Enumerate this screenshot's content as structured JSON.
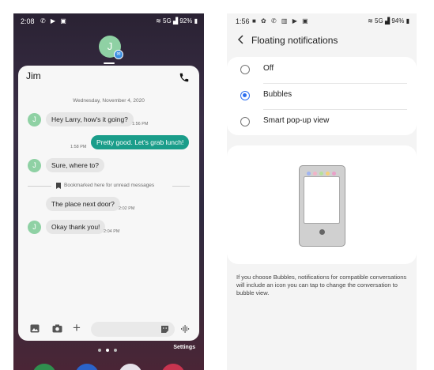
{
  "left_phone": {
    "status": {
      "time": "2:08",
      "battery": "92%",
      "network": "5G"
    },
    "bubble_initial": "J",
    "chat": {
      "contact_name": "Jim",
      "date_separator": "Wednesday, November 4, 2020",
      "messages": [
        {
          "direction": "in",
          "text": "Hey Larry, how's it going?",
          "time": "1:56 PM",
          "avatar": "J"
        },
        {
          "direction": "out",
          "text": "Pretty good. Let's grab lunch!",
          "time": "1:58 PM"
        },
        {
          "direction": "in",
          "text": "Sure, where to?",
          "time": "",
          "avatar": "J"
        },
        {
          "direction": "in",
          "text": "The place next door?",
          "time": "2:02 PM",
          "avatar": ""
        },
        {
          "direction": "in",
          "text": "Okay thank you!",
          "time": "2:04 PM",
          "avatar": "J"
        }
      ],
      "bookmark_text": "Bookmarked here for unread messages"
    },
    "settings_label": "Settings",
    "colors": {
      "bubble": "#1a9d8a",
      "avatar": "#8fd1a4"
    }
  },
  "right_phone": {
    "status": {
      "time": "1:56",
      "battery": "94%",
      "network": "5G"
    },
    "title": "Floating notifications",
    "options": [
      {
        "label": "Off",
        "selected": false
      },
      {
        "label": "Bubbles",
        "selected": true
      },
      {
        "label": "Smart pop-up view",
        "selected": false
      }
    ],
    "help_text": "If you choose Bubbles, notifications for compatible conversations will include an icon you can tap to change the conversation to bubble view.",
    "colors": {
      "radio_selected": "#2d6ff0"
    }
  }
}
